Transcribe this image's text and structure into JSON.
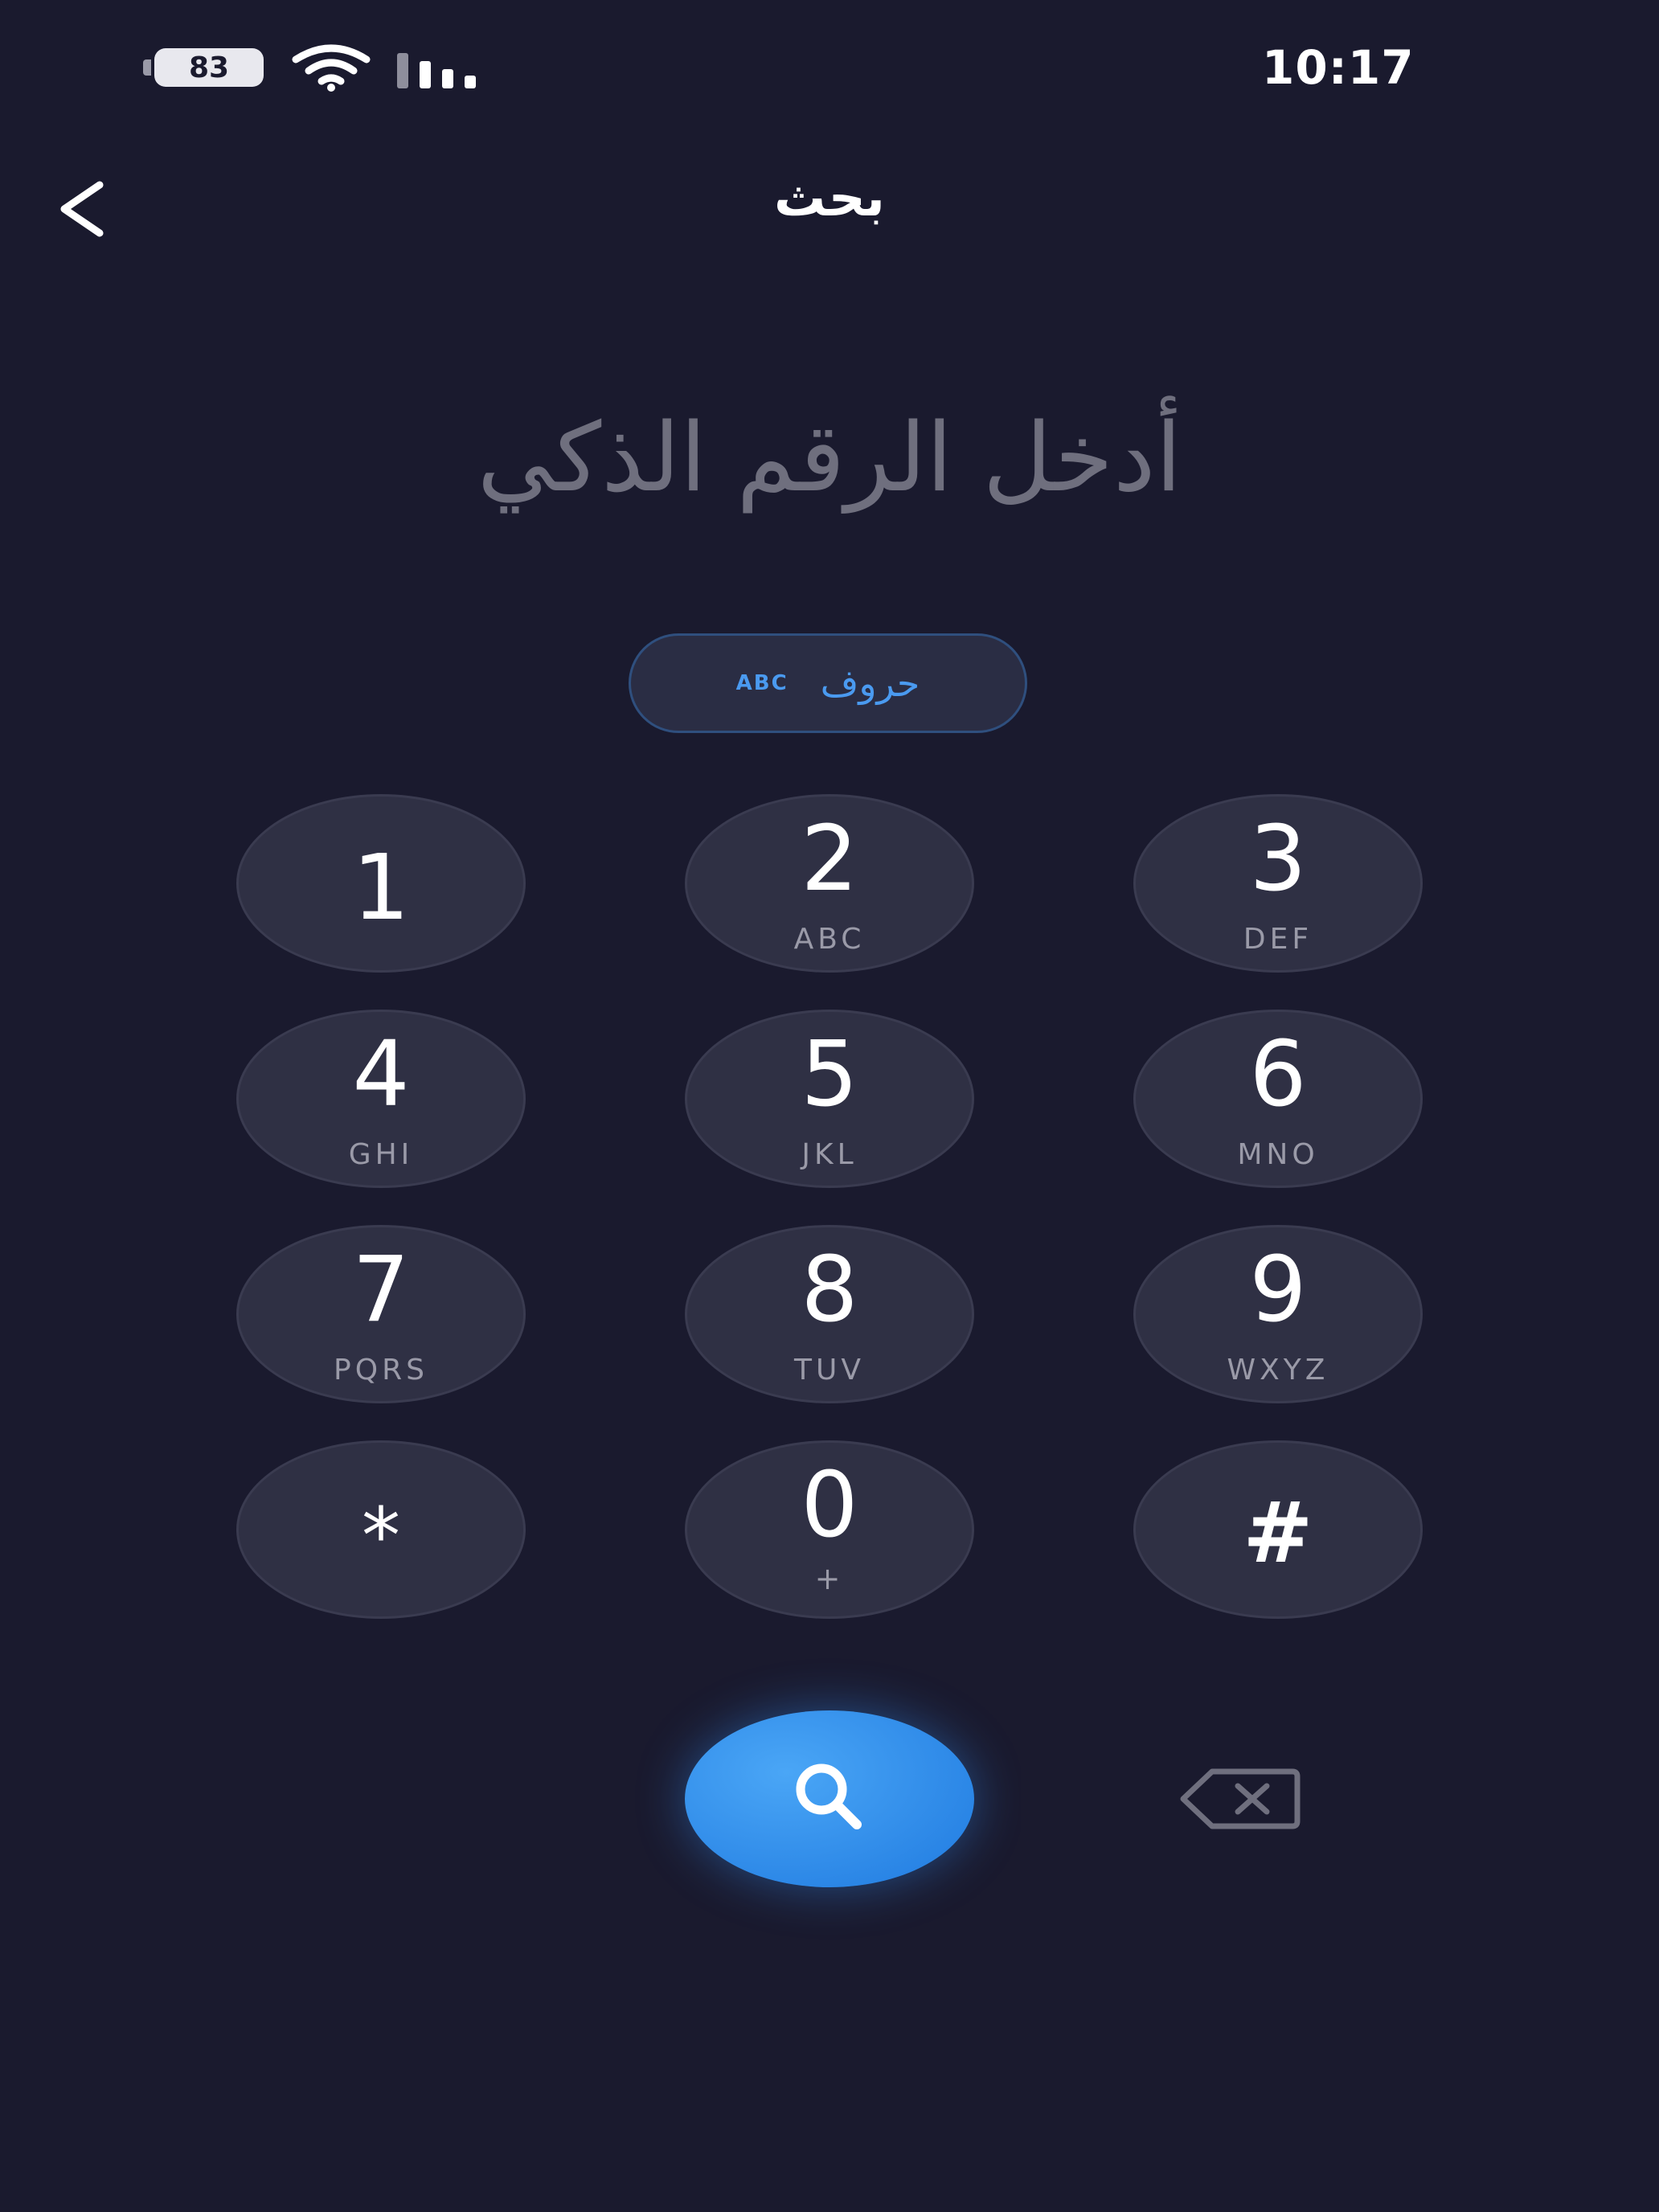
{
  "status_bar": {
    "time": "10:17",
    "battery": "83"
  },
  "header": {
    "title": "بحث"
  },
  "prompt": "أدخل الرقم الذكي",
  "letters_toggle": {
    "badge": "ABC",
    "label": "حروف"
  },
  "keypad": {
    "k1": {
      "digit": "1",
      "letters": ""
    },
    "k2": {
      "digit": "2",
      "letters": "ABC"
    },
    "k3": {
      "digit": "3",
      "letters": "DEF"
    },
    "k4": {
      "digit": "4",
      "letters": "GHI"
    },
    "k5": {
      "digit": "5",
      "letters": "JKL"
    },
    "k6": {
      "digit": "6",
      "letters": "MNO"
    },
    "k7": {
      "digit": "7",
      "letters": "PQRS"
    },
    "k8": {
      "digit": "8",
      "letters": "TUV"
    },
    "k9": {
      "digit": "9",
      "letters": "WXYZ"
    },
    "star": {
      "digit": "*"
    },
    "k0": {
      "digit": "0",
      "letters": "+"
    },
    "hash": {
      "digit": "#"
    }
  },
  "colors": {
    "background": "#1a1a2e",
    "key": "#2f3044",
    "accent": "#3a8ef0",
    "prompt_text": "#6f6f7e"
  },
  "icons": {
    "back": "chevron-left-icon",
    "search": "search-icon",
    "backspace": "backspace-icon",
    "wifi": "wifi-icon",
    "signal": "signal-icon",
    "battery": "battery-icon"
  }
}
